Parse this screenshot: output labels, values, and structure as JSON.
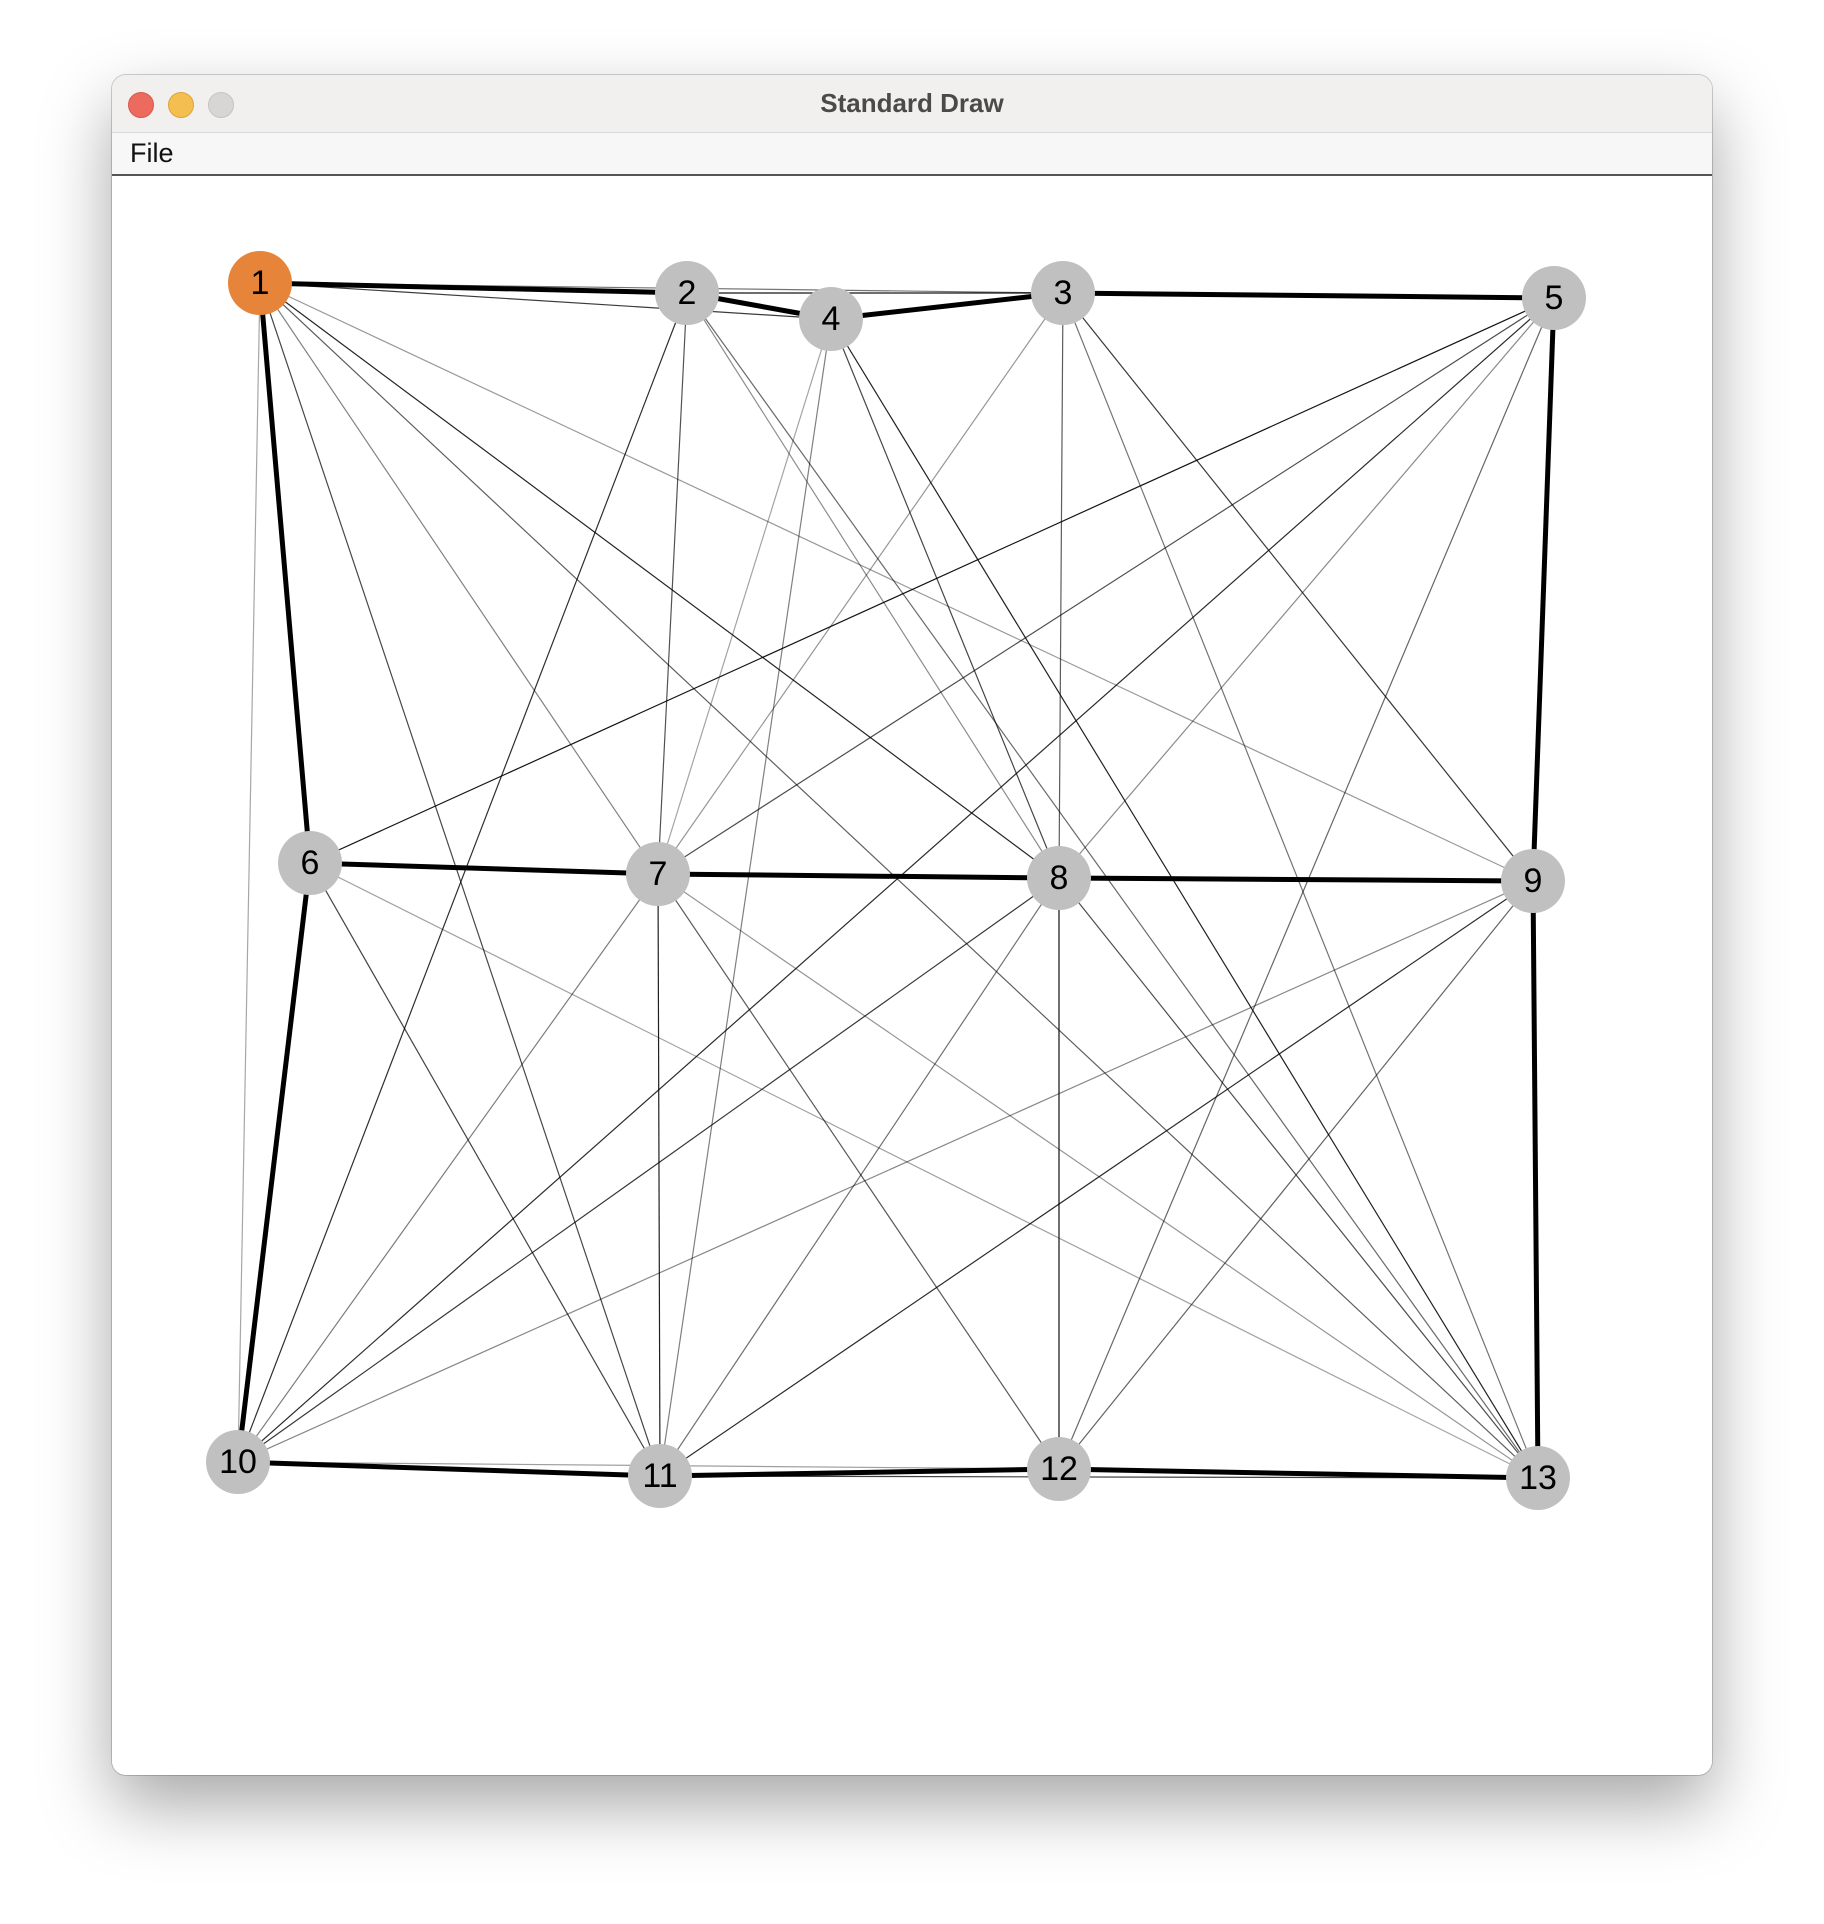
{
  "window": {
    "title": "Standard Draw"
  },
  "menu": {
    "items": [
      {
        "label": "File"
      }
    ]
  },
  "colors": {
    "node_default": "#c0c0c0",
    "node_highlight": "#e6843a",
    "edge": "#000000"
  },
  "graph": {
    "highlighted_node": "1",
    "nodes": [
      "1",
      "2",
      "3",
      "4",
      "5",
      "6",
      "7",
      "8",
      "9",
      "10",
      "11",
      "12",
      "13"
    ],
    "heavy_edges": [
      [
        "1",
        "2"
      ],
      [
        "2",
        "4"
      ],
      [
        "4",
        "3"
      ],
      [
        "3",
        "5"
      ],
      [
        "1",
        "6"
      ],
      [
        "5",
        "9"
      ],
      [
        "6",
        "7"
      ],
      [
        "7",
        "8"
      ],
      [
        "8",
        "9"
      ],
      [
        "6",
        "10"
      ],
      [
        "9",
        "13"
      ],
      [
        "10",
        "11"
      ],
      [
        "11",
        "12"
      ],
      [
        "12",
        "13"
      ]
    ],
    "thin_edges": [
      [
        "1",
        "10"
      ],
      [
        "1",
        "11"
      ],
      [
        "1",
        "7"
      ],
      [
        "1",
        "8"
      ],
      [
        "1",
        "13"
      ],
      [
        "1",
        "9"
      ],
      [
        "1",
        "4"
      ],
      [
        "1",
        "3"
      ],
      [
        "2",
        "3"
      ],
      [
        "2",
        "7"
      ],
      [
        "2",
        "8"
      ],
      [
        "2",
        "10"
      ],
      [
        "2",
        "13"
      ],
      [
        "4",
        "7"
      ],
      [
        "4",
        "8"
      ],
      [
        "4",
        "11"
      ],
      [
        "4",
        "13"
      ],
      [
        "3",
        "8"
      ],
      [
        "3",
        "7"
      ],
      [
        "3",
        "9"
      ],
      [
        "3",
        "13"
      ],
      [
        "5",
        "6"
      ],
      [
        "5",
        "7"
      ],
      [
        "5",
        "8"
      ],
      [
        "5",
        "10"
      ],
      [
        "5",
        "12"
      ],
      [
        "6",
        "13"
      ],
      [
        "6",
        "11"
      ],
      [
        "7",
        "10"
      ],
      [
        "7",
        "11"
      ],
      [
        "7",
        "12"
      ],
      [
        "7",
        "13"
      ],
      [
        "8",
        "10"
      ],
      [
        "8",
        "11"
      ],
      [
        "8",
        "12"
      ],
      [
        "8",
        "13"
      ],
      [
        "9",
        "10"
      ],
      [
        "9",
        "11"
      ],
      [
        "9",
        "12"
      ],
      [
        "10",
        "12"
      ],
      [
        "11",
        "13"
      ]
    ]
  }
}
